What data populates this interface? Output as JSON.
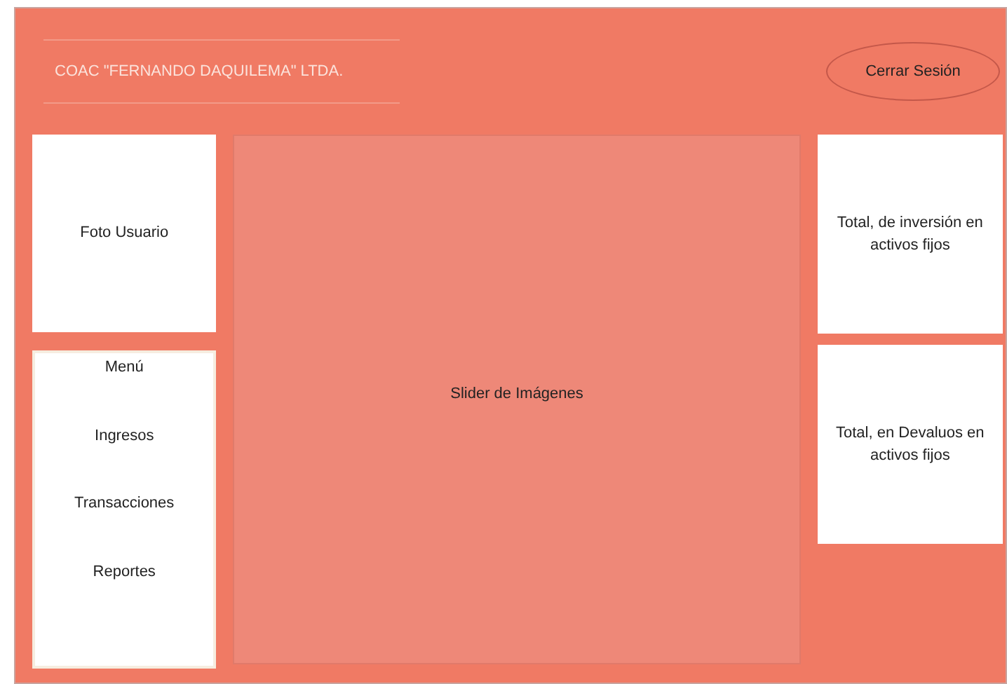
{
  "header": {
    "title": "COAC \"FERNANDO DAQUILEMA\" LTDA.",
    "logout_button": "Cerrar Sesión"
  },
  "user_photo": {
    "label": "Foto Usuario"
  },
  "menu": {
    "title": "Menú",
    "items": [
      {
        "label": "Ingresos"
      },
      {
        "label": "Transacciones"
      },
      {
        "label": "Reportes"
      }
    ]
  },
  "slider": {
    "label": "Slider de Imágenes"
  },
  "totals": [
    {
      "label": "Total, de inversión en activos fijos"
    },
    {
      "label": "Total, en Devaluos en activos fijos"
    }
  ]
}
